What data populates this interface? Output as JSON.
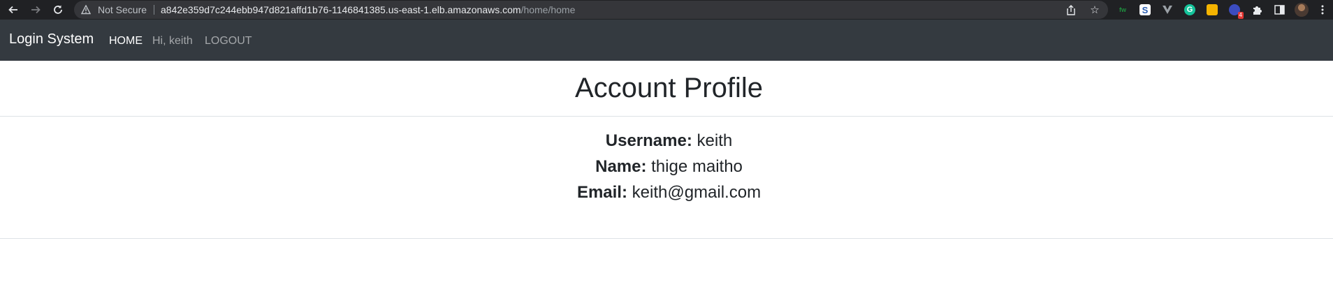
{
  "browser": {
    "not_secure_label": "Not Secure",
    "url_host": "a842e359d7c244ebb947d821affd1b76-1146841385.us-east-1.elb.amazonaws.com",
    "url_path": "/home/home",
    "extension_badge": "4"
  },
  "navbar": {
    "brand": "Login System",
    "links": [
      {
        "label": "HOME"
      },
      {
        "label": "Hi, keith"
      },
      {
        "label": "LOGOUT"
      }
    ]
  },
  "main": {
    "title": "Account Profile",
    "fields": [
      {
        "label": "Username:",
        "value": "keith"
      },
      {
        "label": "Name:",
        "value": "thige maitho"
      },
      {
        "label": "Email:",
        "value": "keith@gmail.com"
      }
    ]
  },
  "colors": {
    "navbar_bg": "#343a40",
    "chrome_bg": "#202124",
    "text": "#212529"
  }
}
